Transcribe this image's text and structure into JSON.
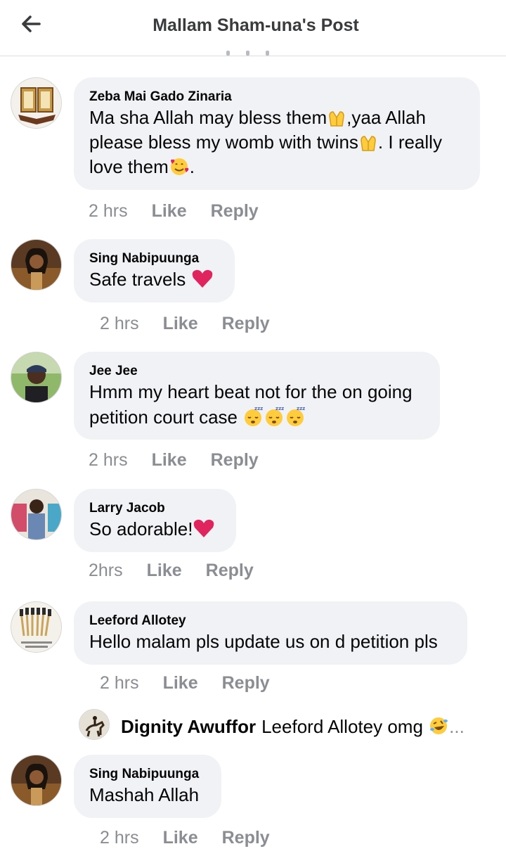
{
  "header": {
    "title": "Mallam Sham-una's Post"
  },
  "comments": [
    {
      "author": "Zeba Mai Gado Zinaria",
      "lines": [
        "Ma sha Allah may bless them",
        ",yaa Allah",
        "please bless my womb with twins",
        ". I really",
        "love  them",
        "."
      ],
      "time": "2 hrs",
      "like": "Like",
      "reply": "Reply"
    },
    {
      "author": "Sing Nabipuunga",
      "text": "Safe travels",
      "time": "2 hrs",
      "like": "Like",
      "reply": "Reply"
    },
    {
      "author": "Jee Jee",
      "line1": "Hmm my heart beat not for the on going",
      "line2": "petition court case",
      "time": "2 hrs",
      "like": "Like",
      "reply": "Reply"
    },
    {
      "author": "Larry Jacob",
      "text": "So adorable!",
      "time": "2hrs",
      "like": "Like",
      "reply": "Reply"
    },
    {
      "author": "Leeford Allotey",
      "text": "Hello malam pls update us on d petition pls",
      "time": "2 hrs",
      "like": "Like",
      "reply": "Reply"
    },
    {
      "author": "Sing Nabipuunga",
      "text": "Mashah Allah",
      "time": "2 hrs",
      "like": "Like",
      "reply": "Reply"
    }
  ],
  "reply_preview": {
    "author": "Dignity Awuffor",
    "text": "Leeford Allotey omg",
    "more": "..."
  },
  "colors": {
    "bubble": "#f0f2f5",
    "meta": "#8a8d91",
    "heart": "#e0245e",
    "emoji_yellow": "#ffcc3e"
  },
  "icons": [
    "back-arrow-icon",
    "praying-hands-emoji-icon",
    "smiling-face-with-hearts-emoji-icon",
    "red-heart-emoji-icon",
    "sleeping-face-emoji-icon",
    "rolling-laughing-emoji-icon"
  ]
}
